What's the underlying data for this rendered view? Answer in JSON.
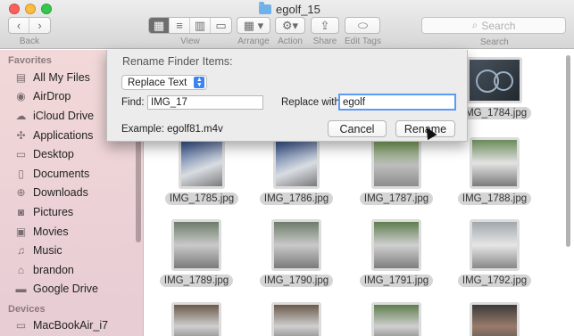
{
  "window": {
    "title": "egolf_15",
    "toolbar": {
      "back_label": "Back",
      "view_label": "View",
      "arrange_label": "Arrange",
      "action_label": "Action",
      "share_label": "Share",
      "edit_tags_label": "Edit Tags",
      "search_placeholder": "Search",
      "search_label": "Search"
    }
  },
  "sidebar": {
    "favorites_header": "Favorites",
    "items": [
      {
        "label": "All My Files",
        "icon": "all-files-icon"
      },
      {
        "label": "AirDrop",
        "icon": "airdrop-icon"
      },
      {
        "label": "iCloud Drive",
        "icon": "cloud-icon"
      },
      {
        "label": "Applications",
        "icon": "applications-icon"
      },
      {
        "label": "Desktop",
        "icon": "desktop-icon"
      },
      {
        "label": "Documents",
        "icon": "documents-icon"
      },
      {
        "label": "Downloads",
        "icon": "downloads-icon"
      },
      {
        "label": "Pictures",
        "icon": "camera-icon"
      },
      {
        "label": "Movies",
        "icon": "film-icon"
      },
      {
        "label": "Music",
        "icon": "music-icon"
      },
      {
        "label": "brandon",
        "icon": "home-icon"
      },
      {
        "label": "Google Drive",
        "icon": "folder-icon"
      }
    ],
    "devices_header": "Devices",
    "devices": [
      {
        "label": "MacBookAir_i7",
        "icon": "laptop-icon"
      }
    ]
  },
  "files": [
    {
      "name": "IMG_1784.jpg"
    },
    {
      "name": "IMG_1785.jpg"
    },
    {
      "name": "IMG_1786.jpg"
    },
    {
      "name": "IMG_1787.jpg"
    },
    {
      "name": "IMG_1788.jpg"
    },
    {
      "name": "IMG_1789.jpg"
    },
    {
      "name": "IMG_1790.jpg"
    },
    {
      "name": "IMG_1791.jpg"
    },
    {
      "name": "IMG_1792.jpg"
    }
  ],
  "dialog": {
    "title": "Rename Finder Items:",
    "mode": "Replace Text",
    "find_label": "Find:",
    "find_value": "IMG_17",
    "replace_label": "Replace with:",
    "replace_value": "egolf",
    "example": "Example: egolf81.m4v",
    "cancel_label": "Cancel",
    "rename_label": "Rename"
  }
}
